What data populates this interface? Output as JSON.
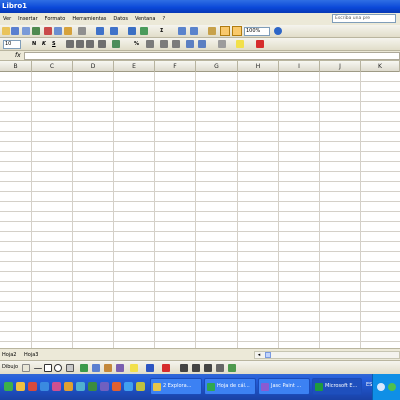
{
  "window": {
    "title": "Libro1"
  },
  "menu": {
    "items": [
      "Ver",
      "Insertar",
      "Formato",
      "Herramientas",
      "Datos",
      "Ventana",
      "?"
    ],
    "help_placeholder": "Escriba una pre"
  },
  "toolbar": {
    "zoom": "100%",
    "font_size": "10",
    "bold": "N",
    "italic": "K",
    "underline": "S",
    "percent": "%",
    "sigma": "Σ"
  },
  "formula_bar": {
    "fx": "fx",
    "content": ""
  },
  "grid": {
    "columns": [
      "B",
      "C",
      "D",
      "E",
      "F",
      "G",
      "H",
      "I",
      "J",
      "K"
    ]
  },
  "sheets": [
    "Hoja2",
    "Hoja3"
  ],
  "drawing": {
    "label": "Dibujo"
  },
  "taskbar": {
    "tasks": [
      {
        "label": "2 Explora...",
        "color": "#e8c64a"
      },
      {
        "label": "Hoja de cál...",
        "color": "#2fa84f"
      },
      {
        "label": "Jasc Paint ...",
        "color": "#8b5bd1"
      },
      {
        "label": "Microsoft E...",
        "color": "#1e9b3e"
      }
    ],
    "lang": "ES"
  },
  "colors": {
    "titlebar": "#0a47d8",
    "taskbar": "#245edc",
    "chrome": "#ece9d8",
    "gridline": "#d4d0c8"
  }
}
